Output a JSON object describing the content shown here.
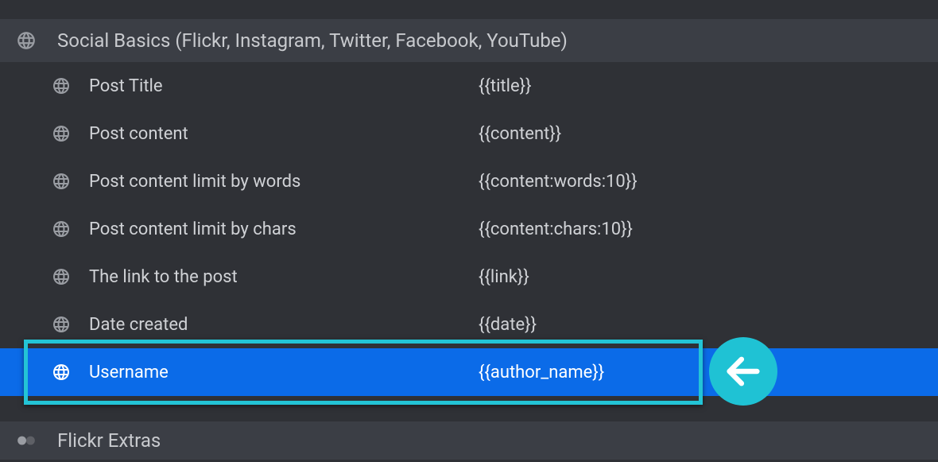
{
  "section1": {
    "title": "Social Basics (Flickr, Instagram, Twitter, Facebook, YouTube)"
  },
  "rows": [
    {
      "label": "Post Title",
      "value": "{{title}}"
    },
    {
      "label": "Post content",
      "value": "{{content}}"
    },
    {
      "label": "Post content limit by words",
      "value": "{{content:words:10}}"
    },
    {
      "label": "Post content limit by chars",
      "value": "{{content:chars:10}}"
    },
    {
      "label": "The link to the post",
      "value": "{{link}}"
    },
    {
      "label": "Date created",
      "value": "{{date}}"
    },
    {
      "label": "Username",
      "value": "{{author_name}}"
    }
  ],
  "section2": {
    "title": "Flickr Extras"
  },
  "colors": {
    "highlight": "#23c4d6",
    "selectedBg": "#0b6be8"
  }
}
